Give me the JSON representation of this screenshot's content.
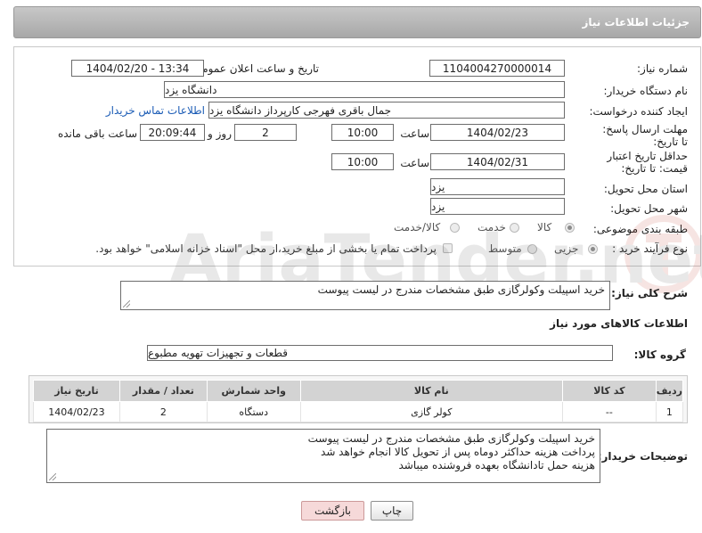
{
  "header": {
    "title": "جزئیات اطلاعات نیاز"
  },
  "form": {
    "need_number_label": "شماره نیاز:",
    "need_number": "1104004270000014",
    "announce_label": "تاریخ و ساعت اعلان عمومی:",
    "announce_value": "1404/02/20 - 13:34",
    "buyer_label": "نام دستگاه خریدار:",
    "buyer_value": "دانشگاه یزد",
    "creator_label": "ایجاد کننده درخواست:",
    "creator_value": "جمال باقری فهرجی کارپرداز دانشگاه یزد",
    "contact_link": "اطلاعات تماس خریدار",
    "deadline_label": "مهلت ارسال پاسخ: تا تاریخ:",
    "deadline_date": "1404/02/23",
    "time_label": "ساعت",
    "deadline_time": "10:00",
    "days_value": "2",
    "days_label": "روز و",
    "remaining_time": "20:09:44",
    "remaining_label": "ساعت باقی مانده",
    "validity_label": "حداقل تاریخ اعتبار قیمت: تا تاریخ:",
    "validity_date": "1404/02/31",
    "validity_time": "10:00",
    "province_label": "استان محل تحویل:",
    "province_value": "یزد",
    "city_label": "شهر محل تحویل:",
    "city_value": "یزد",
    "category_label": "طبقه بندی موضوعی:",
    "category_options": [
      "کالا",
      "خدمت",
      "کالا/خدمت"
    ],
    "category_selected": "کالا",
    "process_label": "نوع فرآیند خرید :",
    "process_options": [
      "جزیی",
      "متوسط"
    ],
    "process_selected": "جزیی",
    "payment_note": "پرداخت تمام یا بخشی از مبلغ خرید،از محل \"اسناد خزانه اسلامی\" خواهد بود."
  },
  "description": {
    "label": "شرح کلی نیاز:",
    "value": "خرید اسپیلت وکولرگازی طبق مشخصات مندرج در لیست پیوست"
  },
  "goods": {
    "section_title": "اطلاعات کالاهای مورد نیاز",
    "group_label": "گروه کالا:",
    "group_value": "قطعات و تجهیزات تهویه مطبوع",
    "columns": [
      "ردیف",
      "کد کالا",
      "نام کالا",
      "واحد شمارش",
      "تعداد / مقدار",
      "تاریخ نیاز"
    ],
    "rows": [
      {
        "row": "1",
        "code": "--",
        "name": "کولر گازی",
        "unit": "دستگاه",
        "qty": "2",
        "date": "1404/02/23"
      }
    ]
  },
  "buyer_notes": {
    "label": "توضیحات خریدار:",
    "lines": [
      "خرید اسپیلت وکولرگازی طبق مشخصات مندرج در لیست پیوست",
      "پرداخت هزینه حداکثر دوماه پس از تحویل کالا انجام خواهد شد",
      "هزینه حمل تادانشگاه بعهده فروشنده میباشد"
    ]
  },
  "buttons": {
    "print": "چاپ",
    "back": "بازگشت"
  },
  "watermark": {
    "text": "AriaTender.net"
  },
  "colors": {
    "header_bg": "#b5b5b5",
    "link": "#1a5bb5",
    "back_button": "#f6d9d9",
    "table_header": "#d3d3d3"
  }
}
